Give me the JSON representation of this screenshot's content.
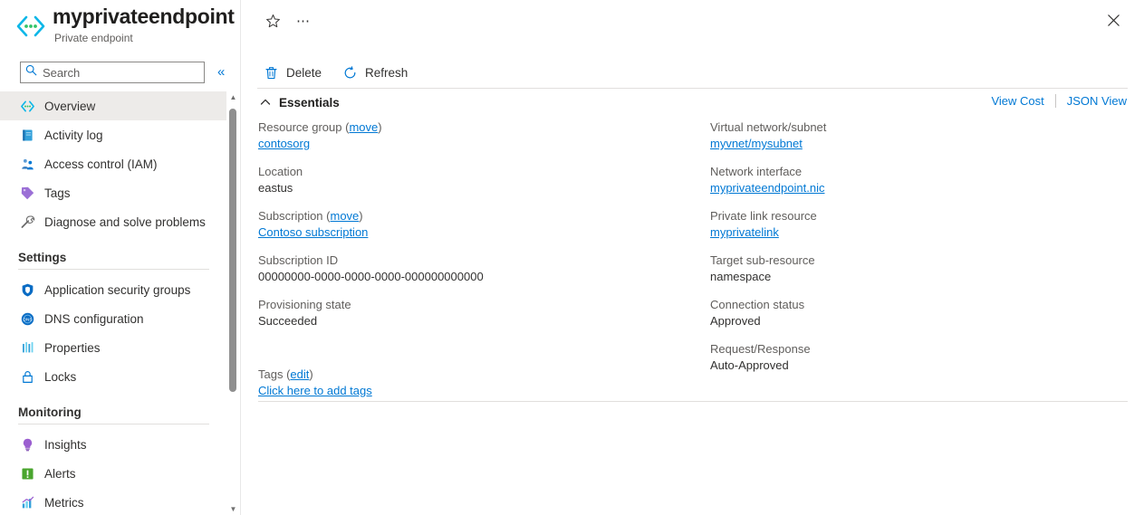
{
  "resource": {
    "icon": "private-endpoint-icon",
    "title": "myprivateendpoint",
    "subtitle": "Private endpoint"
  },
  "search": {
    "placeholder": "Search",
    "value": "",
    "icon": "search-icon",
    "collapse_icon": "chevron-double-left-icon"
  },
  "sidebar": {
    "items": [
      {
        "label": "Overview",
        "icon": "private-endpoint-icon",
        "selected": true
      },
      {
        "label": "Activity log",
        "icon": "activity-log-icon",
        "selected": false
      },
      {
        "label": "Access control (IAM)",
        "icon": "access-control-icon",
        "selected": false
      },
      {
        "label": "Tags",
        "icon": "tag-icon",
        "selected": false
      },
      {
        "label": "Diagnose and solve problems",
        "icon": "wrench-icon",
        "selected": false
      }
    ],
    "groups": [
      {
        "title": "Settings",
        "items": [
          {
            "label": "Application security groups",
            "icon": "shield-icon"
          },
          {
            "label": "DNS configuration",
            "icon": "dns-icon"
          },
          {
            "label": "Properties",
            "icon": "properties-icon"
          },
          {
            "label": "Locks",
            "icon": "lock-icon"
          }
        ]
      },
      {
        "title": "Monitoring",
        "items": [
          {
            "label": "Insights",
            "icon": "lightbulb-icon"
          },
          {
            "label": "Alerts",
            "icon": "alert-icon"
          },
          {
            "label": "Metrics",
            "icon": "metrics-icon"
          }
        ]
      }
    ]
  },
  "header_actions": {
    "favorite_icon": "star-icon",
    "more_icon": "ellipsis-icon",
    "close_icon": "close-icon"
  },
  "toolbar": {
    "buttons": [
      {
        "label": "Delete",
        "icon": "trash-icon"
      },
      {
        "label": "Refresh",
        "icon": "refresh-icon"
      }
    ]
  },
  "essentials": {
    "title": "Essentials",
    "collapse_icon": "chevron-up-icon",
    "view_cost_label": "View Cost",
    "json_view_label": "JSON View",
    "left_fields": [
      {
        "label": "Resource group",
        "label_link": "move",
        "value": "contosorg",
        "value_is_link": true
      },
      {
        "label": "Location",
        "value": "eastus",
        "value_is_link": false
      },
      {
        "label": "Subscription",
        "label_link": "move",
        "value": "Contoso subscription",
        "value_is_link": true
      },
      {
        "label": "Subscription ID",
        "value": "00000000-0000-0000-0000-000000000000",
        "value_is_link": false
      },
      {
        "label": "Provisioning state",
        "value": "Succeeded",
        "value_is_link": false
      }
    ],
    "right_fields": [
      {
        "label": "Virtual network/subnet",
        "value": "myvnet/mysubnet",
        "value_is_link": true
      },
      {
        "label": "Network interface",
        "value": "myprivateendpoint.nic",
        "value_is_link": true
      },
      {
        "label": "Private link resource",
        "value": "myprivatelink",
        "value_is_link": true
      },
      {
        "label": "Target sub-resource",
        "value": "namespace",
        "value_is_link": false
      },
      {
        "label": "Connection status",
        "value": "Approved",
        "value_is_link": false
      },
      {
        "label": "Request/Response",
        "value": "Auto-Approved",
        "value_is_link": false
      }
    ],
    "tags": {
      "label": "Tags",
      "edit_label": "edit",
      "add_label": "Click here to add tags"
    }
  },
  "colors": {
    "accent": "#0078d4",
    "selected_row": "#edebe9",
    "label_text": "#605e5c",
    "body_text": "#323130",
    "divider": "#e1dfdd"
  }
}
